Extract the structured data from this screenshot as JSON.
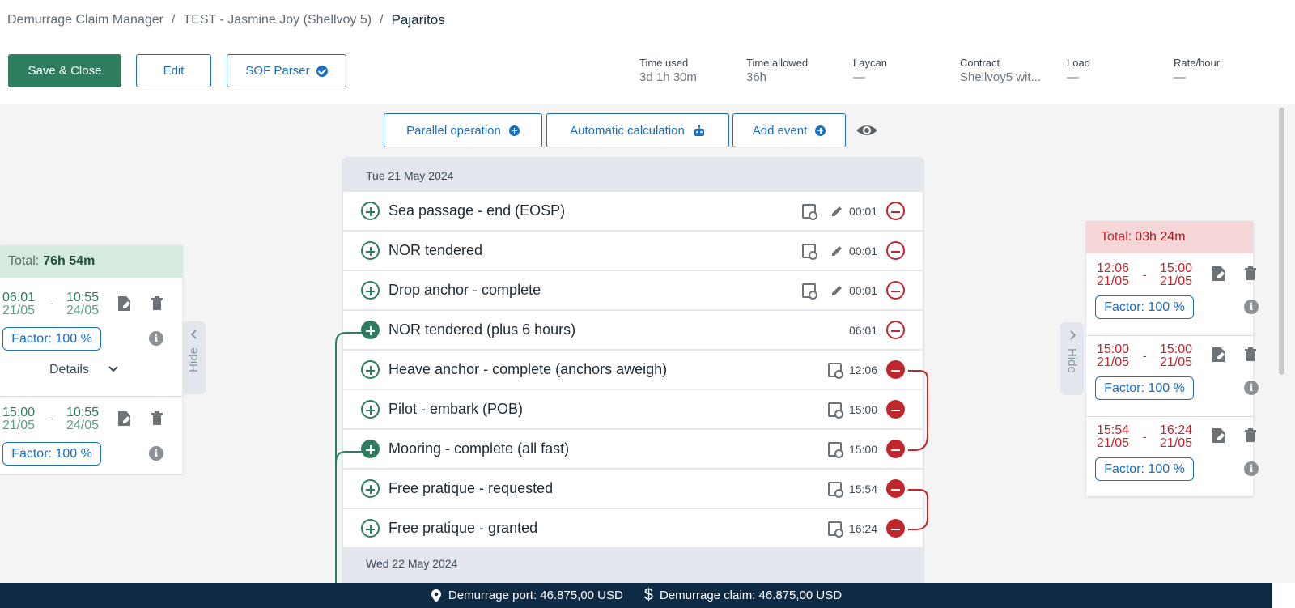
{
  "breadcrumb": {
    "items": [
      "Demurrage Claim Manager",
      "TEST - Jasmine Joy (Shellvoy 5)"
    ],
    "current": "Pajaritos"
  },
  "actions": {
    "save_close": "Save & Close",
    "edit": "Edit",
    "sof_parser": "SOF Parser"
  },
  "stats": [
    {
      "label": "Time used",
      "value": "3d 1h 30m"
    },
    {
      "label": "Time allowed",
      "value": "36h"
    },
    {
      "label": "Laycan",
      "value": "—"
    },
    {
      "label": "Contract",
      "value": "Shellvoy5 wit..."
    },
    {
      "label": "Load",
      "value": "—"
    },
    {
      "label": "Rate/hour",
      "value": "—"
    }
  ],
  "toolbar": {
    "parallel": "Parallel operation",
    "automatic": "Automatic calculation",
    "add_event": "Add event"
  },
  "timeline": {
    "day1": "Tue 21 May 2024",
    "day2": "Wed 22 May 2024",
    "events": [
      {
        "name": "Sea passage - end (EOSP)",
        "time": "00:01"
      },
      {
        "name": "NOR tendered",
        "time": "00:01"
      },
      {
        "name": "Drop anchor - complete",
        "time": "00:01"
      },
      {
        "name": "NOR tendered (plus 6 hours)",
        "time": "06:01"
      },
      {
        "name": "Heave anchor - complete (anchors aweigh)",
        "time": "12:06"
      },
      {
        "name": "Pilot - embark (POB)",
        "time": "15:00"
      },
      {
        "name": "Mooring - complete (all fast)",
        "time": "15:00"
      },
      {
        "name": "Free pratique - requested",
        "time": "15:54"
      },
      {
        "name": "Free pratique - granted",
        "time": "16:24"
      }
    ]
  },
  "left_panel": {
    "total_label": "Total:",
    "total_value": "76h 54m",
    "hide": "Hide",
    "details": "Details",
    "entries": [
      {
        "start_time": "06:01",
        "start_date": "21/05",
        "end_time": "10:55",
        "end_date": "24/05",
        "factor": "Factor: 100 %"
      },
      {
        "start_time": "15:00",
        "start_date": "21/05",
        "end_time": "10:55",
        "end_date": "24/05",
        "factor": "Factor: 100 %"
      }
    ]
  },
  "right_panel": {
    "total_label": "Total:",
    "total_value": "03h 24m",
    "hide": "Hide",
    "entries": [
      {
        "start_time": "12:06",
        "start_date": "21/05",
        "end_time": "15:00",
        "end_date": "21/05",
        "factor": "Factor: 100 %"
      },
      {
        "start_time": "15:00",
        "start_date": "21/05",
        "end_time": "15:00",
        "end_date": "21/05",
        "factor": "Factor: 100 %"
      },
      {
        "start_time": "15:54",
        "start_date": "21/05",
        "end_time": "16:24",
        "end_date": "21/05",
        "factor": "Factor: 100 %"
      }
    ]
  },
  "footer": {
    "port": "Demurrage port: 46.875,00 USD",
    "claim": "Demurrage claim: 46.875,00 USD"
  },
  "colors": {
    "green": "#2f7d5f",
    "blue": "#1a6fc2",
    "red": "#c0272d",
    "navy": "#0f2a44"
  }
}
